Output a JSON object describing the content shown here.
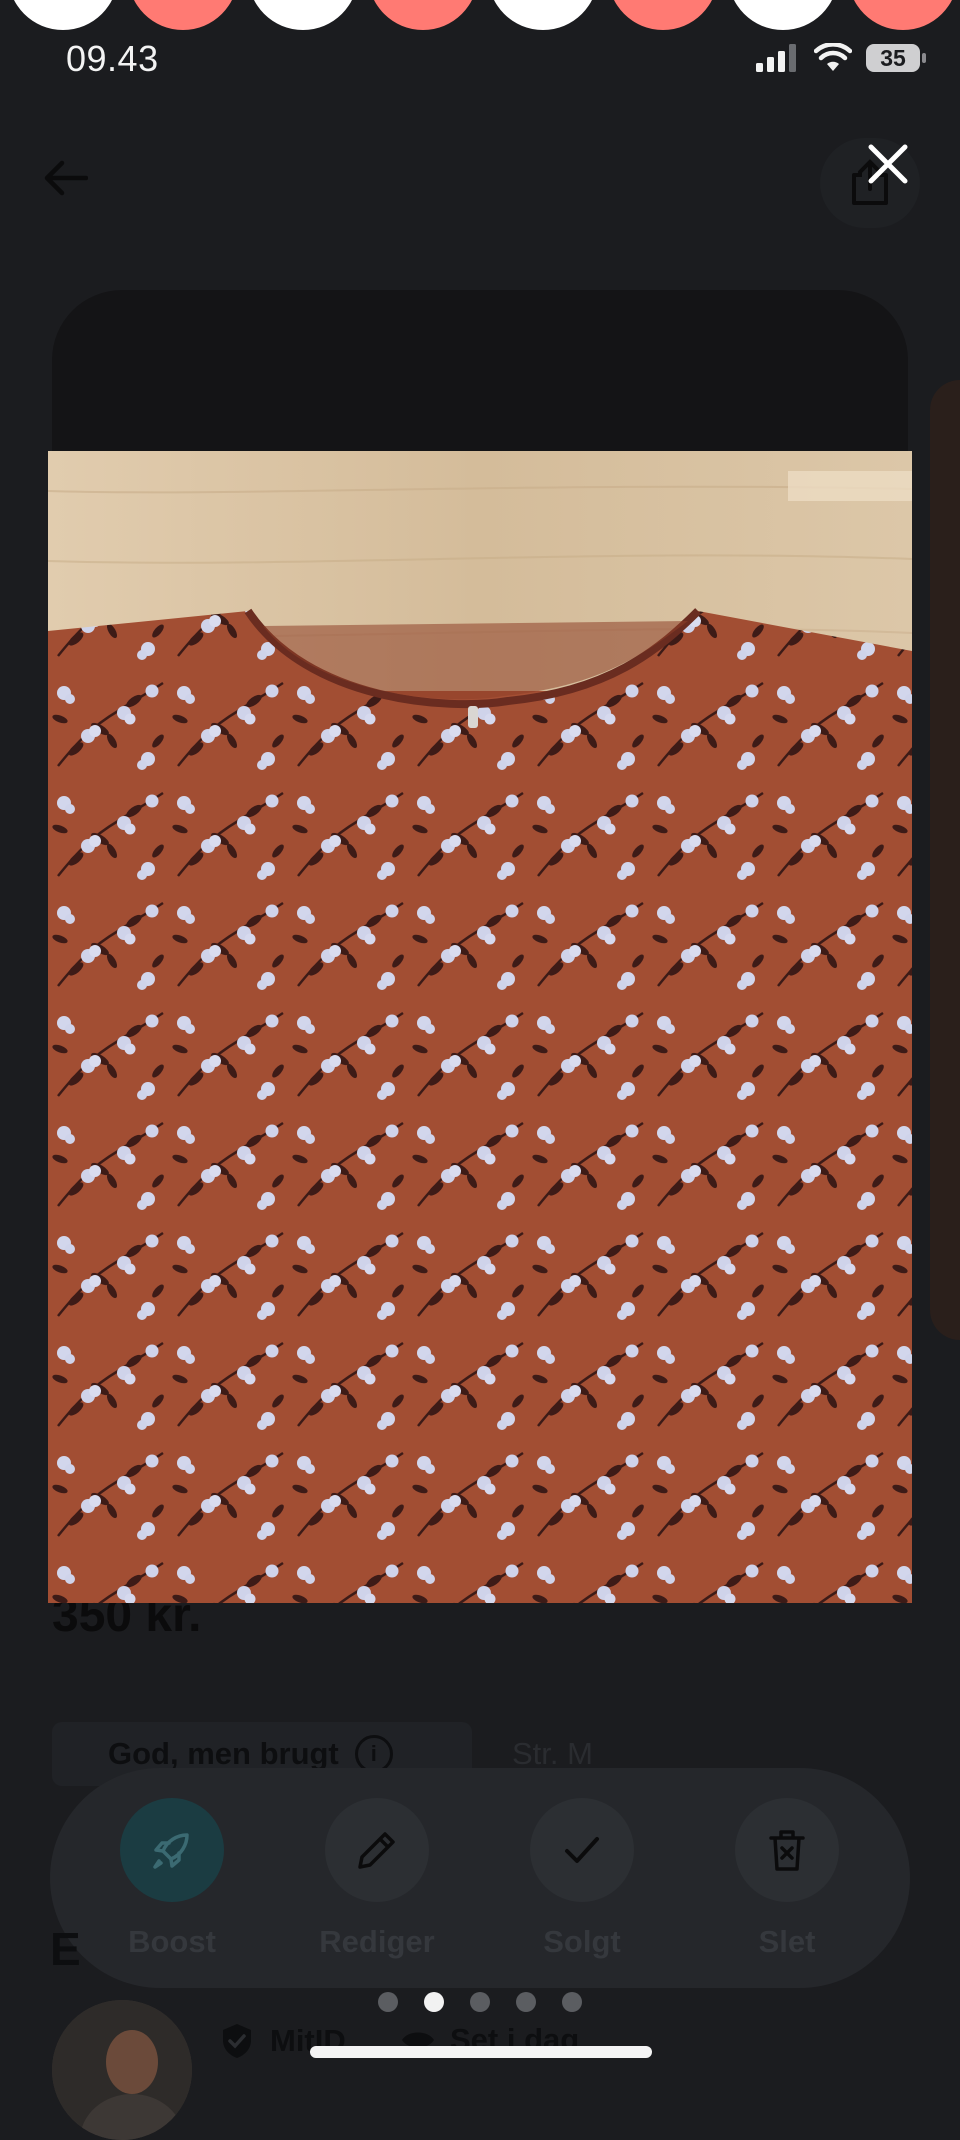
{
  "status_bar": {
    "time": "09.43",
    "battery": "35"
  },
  "listing": {
    "price": "350 kr.",
    "condition": "God, men brugt",
    "size": "Str. M",
    "section_heading_partial": "E"
  },
  "actions": [
    {
      "label": "Boost",
      "icon": "rocket-icon"
    },
    {
      "label": "Rediger",
      "icon": "pencil-icon"
    },
    {
      "label": "Solgt",
      "icon": "checkmark-icon"
    },
    {
      "label": "Slet",
      "icon": "trash-icon"
    }
  ],
  "seller": {
    "verification": "MitID",
    "last_seen": "Set i dag"
  },
  "gallery": {
    "image_count": 5,
    "current_index": 2
  },
  "colors": {
    "accent": "#ff7a73",
    "background": "#1b1c1f",
    "boost": "#1b3c42"
  }
}
